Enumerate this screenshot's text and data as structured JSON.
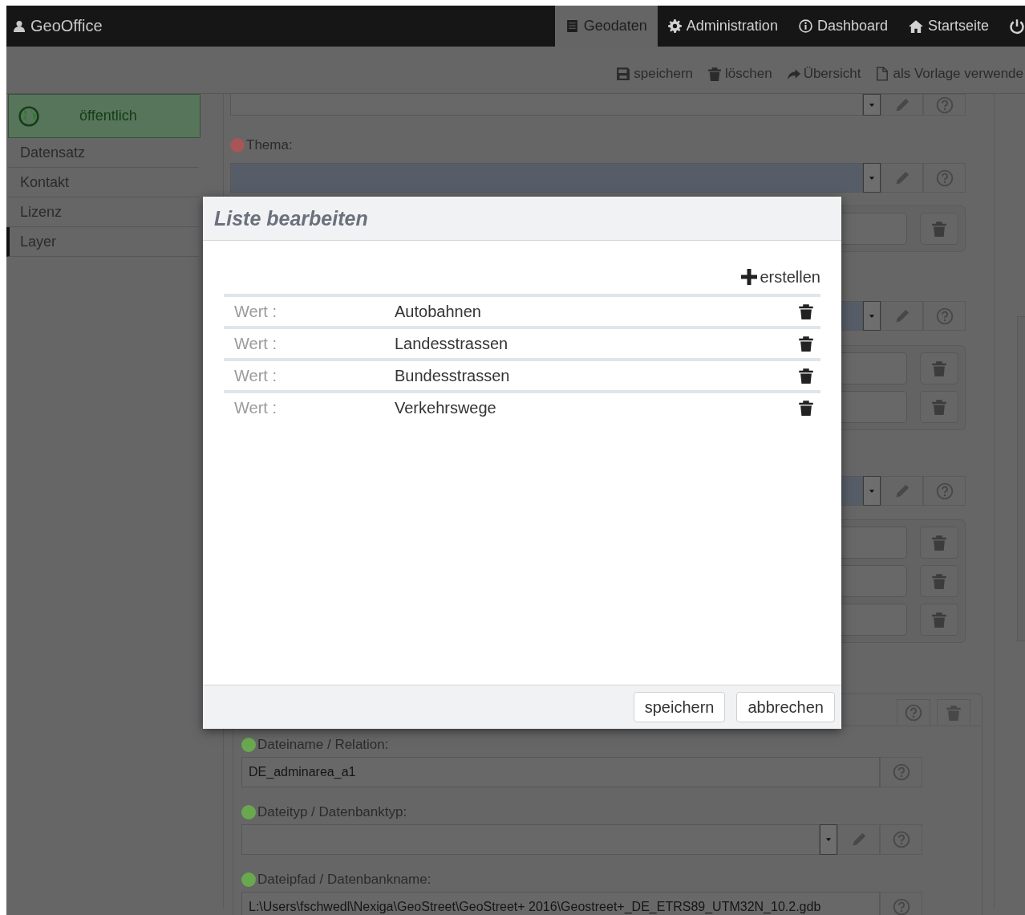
{
  "nav": {
    "brand": "GeoOffice",
    "items": [
      {
        "label": "Geodaten",
        "selected": true
      },
      {
        "label": "Administration",
        "selected": false
      },
      {
        "label": "Dashboard",
        "selected": false
      },
      {
        "label": "Startseite",
        "selected": false
      }
    ]
  },
  "toolbar": [
    {
      "label": "speichern"
    },
    {
      "label": "löschen"
    },
    {
      "label": "Übersicht"
    },
    {
      "label": "als Vorlage verwende"
    }
  ],
  "sidebar": {
    "status": "öffentlich",
    "items": [
      {
        "label": "Datensatz",
        "selected": false
      },
      {
        "label": "Kontakt",
        "selected": false
      },
      {
        "label": "Lizenz",
        "selected": false
      },
      {
        "label": "Layer",
        "selected": true
      }
    ]
  },
  "form": {
    "rows": [
      {
        "kind": "select",
        "focused": false
      },
      {
        "kind": "label",
        "label": "Thema:",
        "color": "#a65656"
      },
      {
        "kind": "select",
        "focused": true
      },
      {
        "kind": "group",
        "entries": [
          {
            "kind": "input"
          }
        ]
      },
      {
        "kind": "select",
        "focused": true
      },
      {
        "kind": "group",
        "entries": [
          {
            "kind": "input"
          },
          {
            "kind": "input"
          }
        ]
      },
      {
        "kind": "select",
        "focused": true
      },
      {
        "kind": "group",
        "entries": [
          {
            "kind": "input"
          },
          {
            "kind": "input"
          },
          {
            "kind": "input"
          }
        ]
      }
    ]
  },
  "layer_panel": {
    "fields": [
      {
        "kind": "input",
        "label": "Dateiname / Relation:",
        "color": "#6aa84f",
        "value": "DE_adminarea_a1"
      },
      {
        "kind": "select",
        "label": "Dateityp / Datenbanktyp:",
        "color": "#6aa84f"
      },
      {
        "kind": "input",
        "label": "Dateipfad / Datenbankname:",
        "color": "#6aa84f",
        "value": "L:\\Users\\fschwedl\\Nexiga\\GeoStreet\\GeoStreet+ 2016\\Geostreet+_DE_ETRS89_UTM32N_10.2.gdb"
      }
    ]
  },
  "modal": {
    "title": "Liste bearbeiten",
    "create": "erstellen",
    "rows": [
      {
        "label": "Wert :",
        "value": "Autobahnen"
      },
      {
        "label": "Wert :",
        "value": "Landesstrassen"
      },
      {
        "label": "Wert :",
        "value": "Bundesstrassen"
      },
      {
        "label": "Wert :",
        "value": "Verkehrswege"
      }
    ],
    "buttons": [
      {
        "label": "speichern"
      },
      {
        "label": "abbrechen"
      }
    ]
  }
}
